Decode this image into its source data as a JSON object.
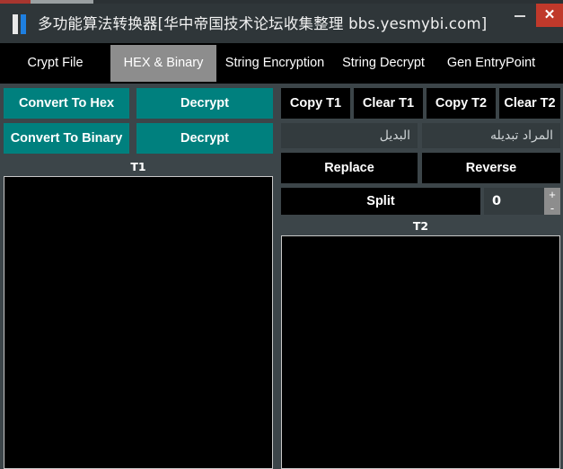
{
  "window": {
    "title": "多功能算法转换器[华中帝国技术论坛收集整理 bbs.yesmybi.com]",
    "icon": "app-bars-icon",
    "minimize_label": "",
    "close_label": "✕",
    "accent_teal": "#00807e",
    "accent_close_red": "#c0392b",
    "panel_bg": "#3c4549",
    "titlebar_bg": "#2f3639"
  },
  "tabs": [
    {
      "label": "Crypt File",
      "active": false
    },
    {
      "label": "HEX & Binary",
      "active": true
    },
    {
      "label": "String Encryption",
      "active": false
    },
    {
      "label": "String Decrypt",
      "active": false
    },
    {
      "label": "Gen EntryPoint",
      "active": false
    }
  ],
  "left_panel": {
    "convert_to_hex": "Convert To Hex",
    "decrypt_hex": "Decrypt",
    "convert_to_binary": "Convert To Binary",
    "decrypt_binary": "Decrypt",
    "t1_label": "T1",
    "t1_value": ""
  },
  "right_panel": {
    "copy_t1": "Copy T1",
    "clear_t1": "Clear T1",
    "copy_t2": "Copy T2",
    "clear_t2": "Clear T2",
    "replacement_placeholder": "البديل",
    "replacement_value": "",
    "target_placeholder": "المراد تبديله",
    "target_value": "",
    "replace": "Replace",
    "reverse": "Reverse",
    "split": "Split",
    "split_count": "0",
    "spin_up": "+",
    "spin_down": "-",
    "t2_label": "T2",
    "t2_value": ""
  }
}
